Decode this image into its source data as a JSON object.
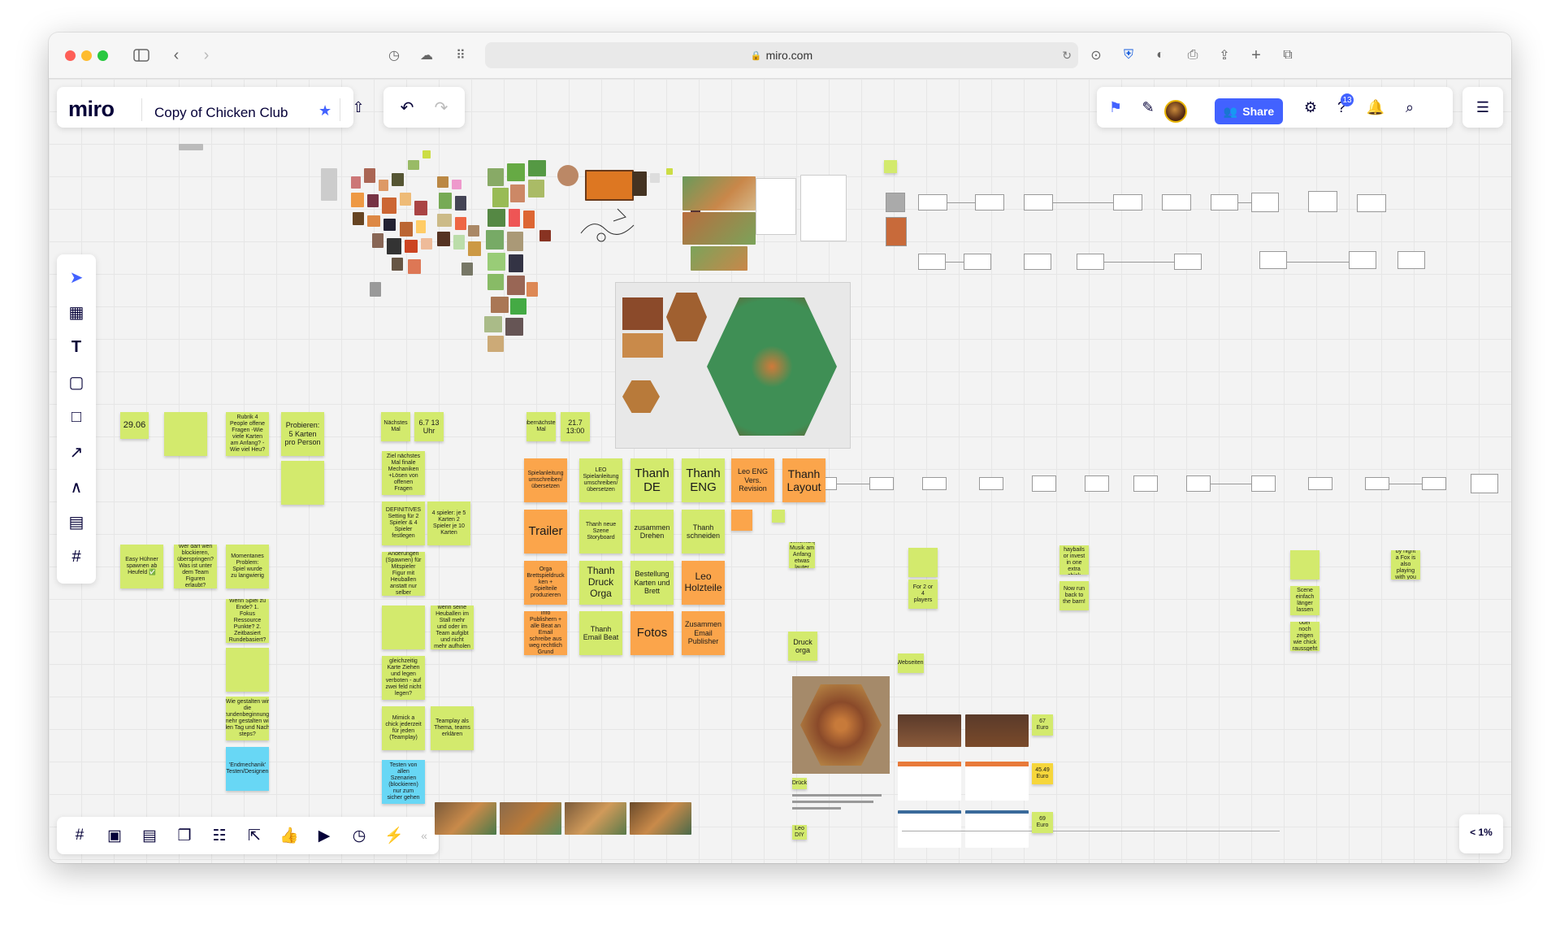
{
  "browser": {
    "url": "miro.com"
  },
  "app": {
    "logo": "miro",
    "board_title": "Copy of Chicken Club",
    "share_label": "Share",
    "notifications_count": "13",
    "zoom": "< 1%"
  },
  "colors": {
    "accent": "#4262ff",
    "sticky_green": "#d3ea6d",
    "sticky_orange": "#fba54b",
    "sticky_blue": "#68d7f5",
    "sticky_yellow": "#f6d63b"
  },
  "left_toolbar": [
    "select-icon",
    "templates-icon",
    "text-icon",
    "sticky-note-icon",
    "shape-icon",
    "connector-icon",
    "pen-icon",
    "comment-icon",
    "frame-icon",
    "upload-icon",
    "more-icon"
  ],
  "bottom_toolbar": [
    "frames-icon",
    "presentation-icon",
    "comments-icon",
    "cards-icon",
    "kanban-icon",
    "share-screen-icon",
    "reactions-icon",
    "video-icon",
    "timer-icon",
    "lightning-icon",
    "collapse-icon"
  ],
  "stickies": {
    "s1": "29.06",
    "s2": "Rubrik 4 People offene Fragen -Wie viele Karten am Anfang? -Wie viel Heu?",
    "s3": "Probieren: 5 Karten pro Person",
    "s4": "Nächstes Mal",
    "s5": "6.7 13 Uhr",
    "s6": "übernächstes Mal",
    "s7": "21.7 13:00",
    "s8": "Ziel nächstes Mal finale Mechaniken +Lösen von offenen Fragen",
    "s9": "DEFINITIVES Setting für 2 Spieler & 4 Spieler festlegen",
    "s10": "4 spieler: je 5 Karten 2 Spieler je 10 Karten",
    "s11": "Easy Hühner spawnen ab Heufeld ✅",
    "s12": "Wer darf wen blockieren, überspringen? Was ist unter dem Team Figuren erlaubt?",
    "s13": "Momentanes Problem: Spiel wurde zu langwierig",
    "s14": "Spielanleitung umschreiben/ übersetzen",
    "s15": "LEO Spielanleitung umschreiben/ übersetzen",
    "s16": "Thanh DE",
    "s17": "Thanh ENG",
    "s18": "Leo ENG Vers. Revision",
    "s19": "Thanh Layout",
    "s20": "Trailer",
    "s21": "Thanh neue Szene Storyboard",
    "s22": "zusammen Drehen",
    "s23": "Thanh schneiden",
    "s24": "Orga Brettspieldruck ken + Spielteile produzieren",
    "s25": "Thanh Druck Orga",
    "s26": "Bestellung Karten und Brett",
    "s27": "Leo Holzteile",
    "s28": "Info Publishern + alle Beat an Email schreibe aus weg rechtlich Grund",
    "s29": "Thanh Email Beat",
    "s30": "Fotos",
    "s31": "Zusammen Email Publisher",
    "s32": "Änderungen (Spawnen) für Mitspieler Figur mit Heuballen anstatt nur selber",
    "s33": "Spiel endet wenn seine Heuballen im Stall mehr und oder im Team aufgibt und nicht mehr aufholen kann",
    "s34": "gleichzeitig Karte Ziehen und legen verboten - auf zwei feld nicht legen?",
    "s35": "Mimick a chick jederzeit für jeden (Teamplay)",
    "s36": "Teamplay als Thema, teams erklären",
    "s37": "Testen von allen Szenarien (blockieren) nur zum sicher gehen",
    "s38": "'Endmechanik' Testen/Designen",
    "s39": "Druck orga",
    "s40": "Webseiten:",
    "s41": "For 2 or 4 players",
    "s42": "Take 2 haybails or invest in one extra chick",
    "s43": "Now run back to the barn!",
    "s44": "Surprise, by night a Fox is also playing with you all!",
    "s45": "Anmerkung Musik am Anfang etwas lauter",
    "s46": "Scene einfach länger lassen",
    "s47": "oder noch zeigen wie chick raussgeht",
    "s48": "Drück",
    "s49": "Leo DIY",
    "s50": "67 Euro",
    "s51": "45.49 Euro",
    "s52": "69 Euro",
    "s53": "Wenn Spiel zu Ende? 1. Fokus Ressource Punkte? 2. Zeitbasiert Rundebasiert?",
    "s54": "Wie gestalten wir die Rundenbeginnung? mehr gestalten wir den Tag und Nacht steps?"
  }
}
